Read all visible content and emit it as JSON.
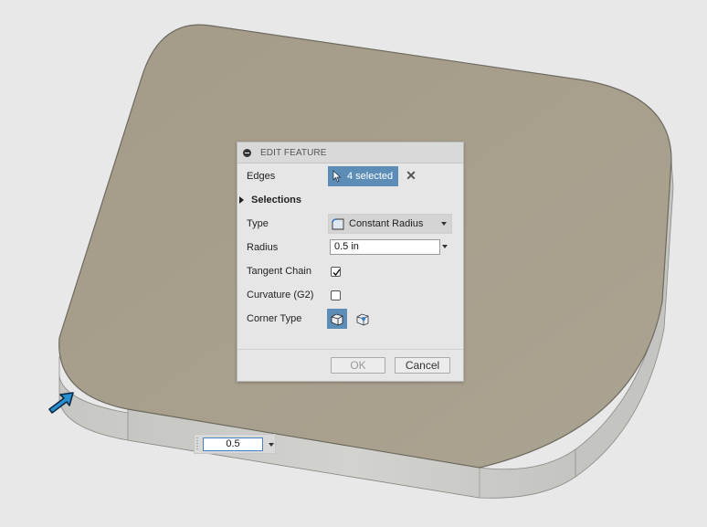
{
  "dialog": {
    "title": "EDIT FEATURE",
    "edges_label": "Edges",
    "edges_value": "4 selected",
    "clear_label": "✕",
    "selections_label": "Selections",
    "type_label": "Type",
    "type_value": "Constant Radius",
    "radius_label": "Radius",
    "radius_value": "0.5 in",
    "tangent_chain_label": "Tangent Chain",
    "tangent_chain_checked": true,
    "curvature_label": "Curvature (G2)",
    "curvature_checked": false,
    "corner_type_label": "Corner Type",
    "ok_label": "OK",
    "cancel_label": "Cancel"
  },
  "canvas": {
    "dimension_value": "0.5",
    "model_top_color": "#a8a08e",
    "model_side_color": "#c9c9c5",
    "accent_color": "#5b8db6",
    "arrow_color": "#2a8fd0"
  }
}
